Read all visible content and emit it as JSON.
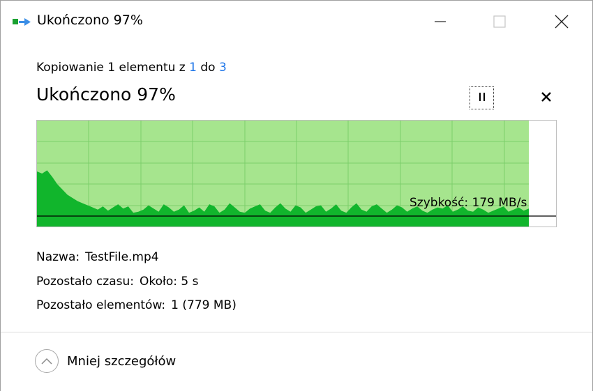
{
  "window": {
    "title": "Ukończono 97%",
    "icons": {
      "app": "copy-transfer-icon",
      "minimize": "minimize-icon",
      "maximize": "maximize-icon",
      "close": "close-icon"
    }
  },
  "header": {
    "subtitle_prefix": "Kopiowanie 1 elementu z ",
    "source": "1",
    "subtitle_mid": " do ",
    "destination": "3",
    "headline": "Ukończono 97%"
  },
  "controls": {
    "pause_icon": "pause-icon",
    "cancel_icon": "cancel-icon"
  },
  "progress": {
    "percent": 97,
    "fill_color": "#a6e58e",
    "speed_fill_color": "#11b52c",
    "grid_color": "#7ccf6a",
    "speed_label": "Szybkość: 179 MB/s",
    "speed_profile": [
      0.52,
      0.5,
      0.53,
      0.47,
      0.4,
      0.35,
      0.3,
      0.27,
      0.24,
      0.22,
      0.2,
      0.18,
      0.16,
      0.19,
      0.15,
      0.18,
      0.21,
      0.17,
      0.19,
      0.13,
      0.14,
      0.16,
      0.2,
      0.17,
      0.14,
      0.21,
      0.18,
      0.14,
      0.16,
      0.2,
      0.13,
      0.15,
      0.18,
      0.14,
      0.21,
      0.19,
      0.13,
      0.16,
      0.22,
      0.18,
      0.14,
      0.13,
      0.17,
      0.19,
      0.21,
      0.15,
      0.13,
      0.18,
      0.22,
      0.17,
      0.14,
      0.2,
      0.18,
      0.13,
      0.16,
      0.19,
      0.2,
      0.14,
      0.17,
      0.21,
      0.15,
      0.13,
      0.18,
      0.22,
      0.16,
      0.14,
      0.19,
      0.21,
      0.17,
      0.13,
      0.16,
      0.2,
      0.18,
      0.14,
      0.17,
      0.19,
      0.15,
      0.13,
      0.16,
      0.18,
      0.17,
      0.2,
      0.14,
      0.16,
      0.19,
      0.15,
      0.14,
      0.18,
      0.16,
      0.13,
      0.15,
      0.17,
      0.19,
      0.14,
      0.16,
      0.18,
      0.15,
      0.17
    ]
  },
  "details": {
    "name_label": "Nazwa:",
    "name_value": "TestFile.mp4",
    "time_label": "Pozostało czasu:",
    "time_value": "Około: 5 s",
    "items_label": "Pozostało elementów:",
    "items_value": "1 (779 MB)"
  },
  "footer": {
    "toggle_icon": "chevron-up-icon",
    "toggle_label": "Mniej szczegółów"
  }
}
